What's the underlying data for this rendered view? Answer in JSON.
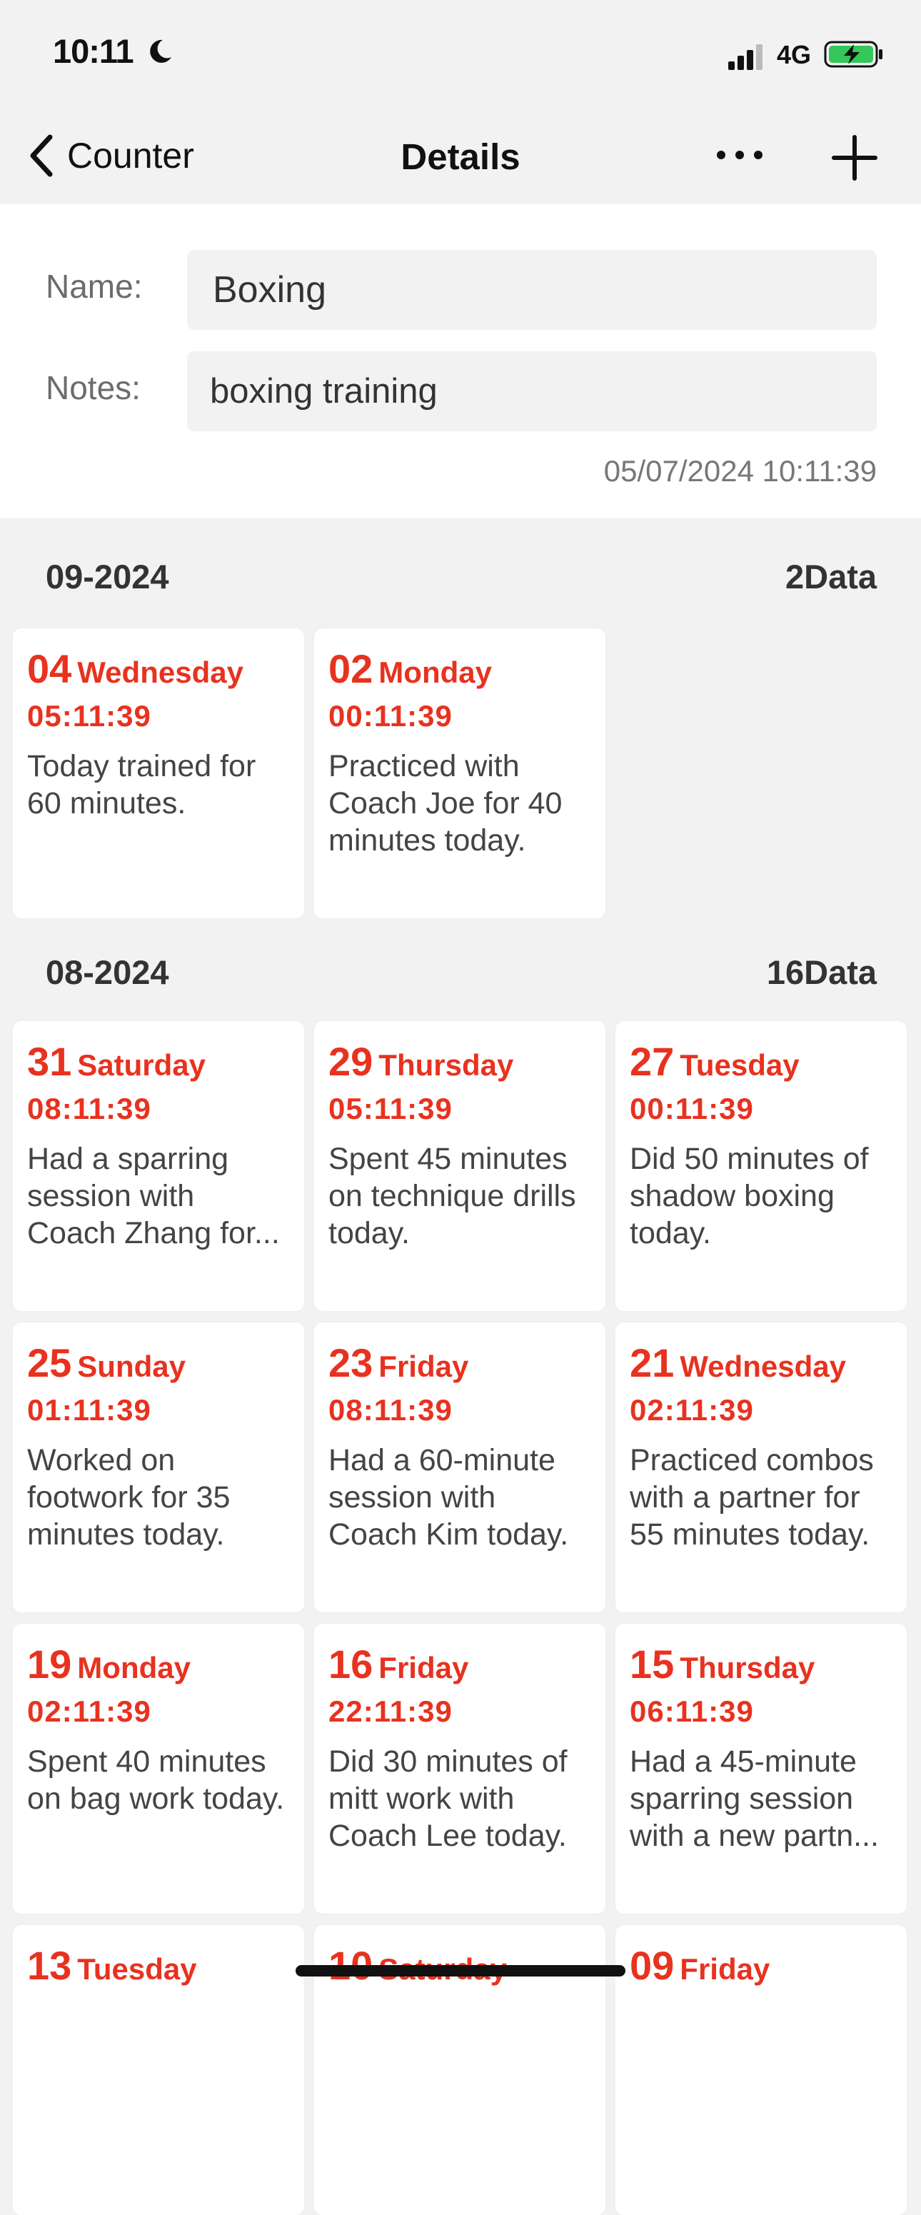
{
  "status_bar": {
    "time": "10:11",
    "network": "4G"
  },
  "nav": {
    "back_label": "Counter",
    "title": "Details"
  },
  "form": {
    "name_label": "Name:",
    "name_value": "Boxing",
    "notes_label": "Notes:",
    "notes_value": "boxing training",
    "created": "05/07/2024 10:11:39"
  },
  "sections": [
    {
      "title": "09-2024",
      "count": "2Data",
      "entries": [
        {
          "day": "04",
          "weekday": "Wednesday",
          "time": "05:11:39",
          "text": "Today trained for 60 minutes."
        },
        {
          "day": "02",
          "weekday": "Monday",
          "time": "00:11:39",
          "text": "Practiced with Coach Joe for 40 minutes today."
        }
      ]
    },
    {
      "title": "08-2024",
      "count": "16Data",
      "entries": [
        {
          "day": "31",
          "weekday": "Saturday",
          "time": "08:11:39",
          "text": "Had a sparring session with Coach Zhang for..."
        },
        {
          "day": "29",
          "weekday": "Thursday",
          "time": "05:11:39",
          "text": "Spent 45 minutes on technique drills today."
        },
        {
          "day": "27",
          "weekday": "Tuesday",
          "time": "00:11:39",
          "text": "Did 50 minutes of shadow boxing today."
        },
        {
          "day": "25",
          "weekday": "Sunday",
          "time": "01:11:39",
          "text": "Worked on footwork for 35 minutes today."
        },
        {
          "day": "23",
          "weekday": "Friday",
          "time": "08:11:39",
          "text": "Had a 60-minute session with Coach Kim today."
        },
        {
          "day": "21",
          "weekday": "Wednesday",
          "time": "02:11:39",
          "text": "Practiced combos with a partner for 55 minutes today."
        },
        {
          "day": "19",
          "weekday": "Monday",
          "time": "02:11:39",
          "text": "Spent 40 minutes on bag work today."
        },
        {
          "day": "16",
          "weekday": "Friday",
          "time": "22:11:39",
          "text": "Did 30 minutes of mitt work with Coach Lee today."
        },
        {
          "day": "15",
          "weekday": "Thursday",
          "time": "06:11:39",
          "text": "Had a 45-minute sparring session with a new partn..."
        },
        {
          "day": "13",
          "weekday": "Tuesday",
          "time": "",
          "text": ""
        },
        {
          "day": "10",
          "weekday": "Saturday",
          "time": "",
          "text": ""
        },
        {
          "day": "09",
          "weekday": "Friday",
          "time": "",
          "text": ""
        }
      ]
    }
  ],
  "colors": {
    "accent_red": "#e8321f",
    "background": "#f2f2f2",
    "card": "#ffffff"
  },
  "icons": [
    "moon-icon",
    "signal-icon",
    "battery-charging-icon",
    "back-chevron-icon",
    "more-icon",
    "plus-icon"
  ]
}
